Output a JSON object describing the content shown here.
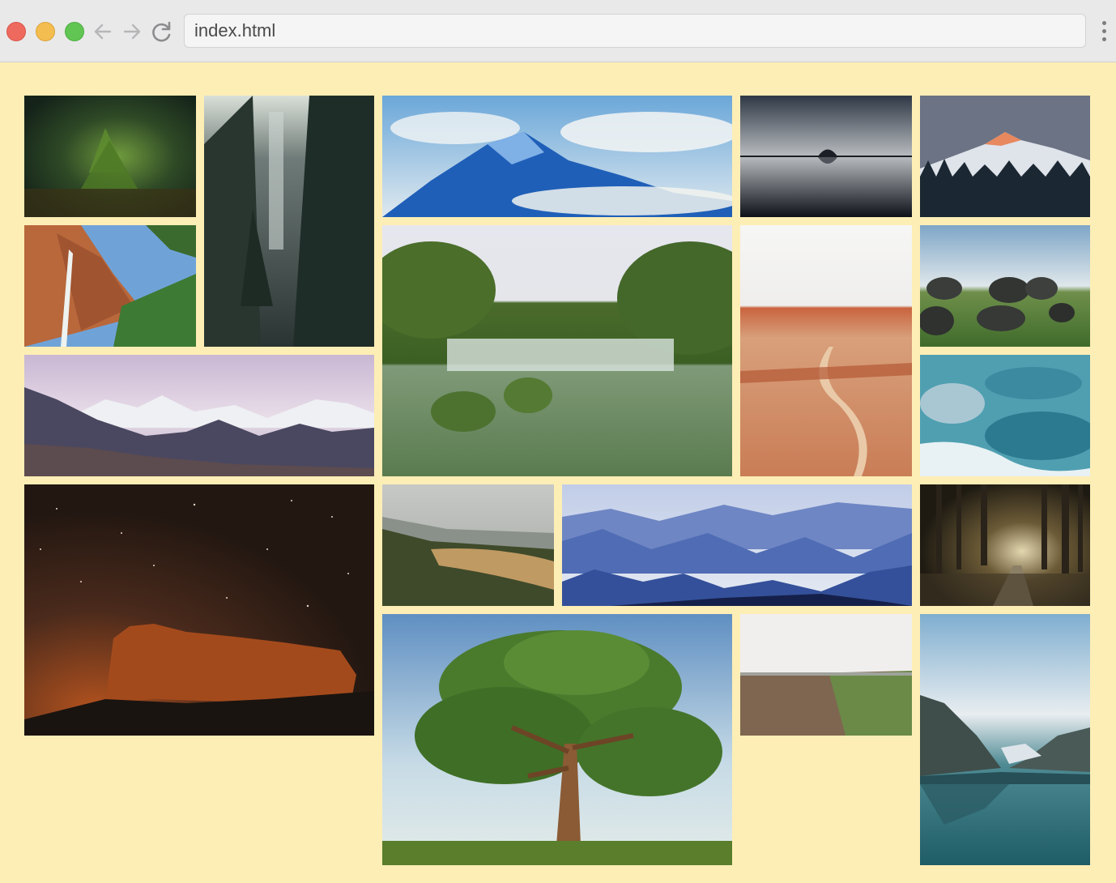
{
  "browser": {
    "address_text": "index.html"
  },
  "gallery": {
    "background_color": "#fdeeb6",
    "photos": [
      {
        "subject": "moss-forest-tree"
      },
      {
        "subject": "forest-waterfall"
      },
      {
        "subject": "mountain-above-clouds"
      },
      {
        "subject": "rock-island-reflection"
      },
      {
        "subject": "sunset-snowy-peaks"
      },
      {
        "subject": "red-canyon-waterfall"
      },
      {
        "subject": "cascading-waterfall-lake"
      },
      {
        "subject": "desert-canyon-path"
      },
      {
        "subject": "boulders-on-grass"
      },
      {
        "subject": "river-rapids"
      },
      {
        "subject": "misty-mountain-range"
      },
      {
        "subject": "night-sky-mesa"
      },
      {
        "subject": "hills-meadow"
      },
      {
        "subject": "blue-misty-mountains"
      },
      {
        "subject": "forest-path"
      },
      {
        "subject": "lone-tree-field"
      },
      {
        "subject": "plowed-field"
      },
      {
        "subject": "mountain-lake-reflection"
      }
    ]
  }
}
